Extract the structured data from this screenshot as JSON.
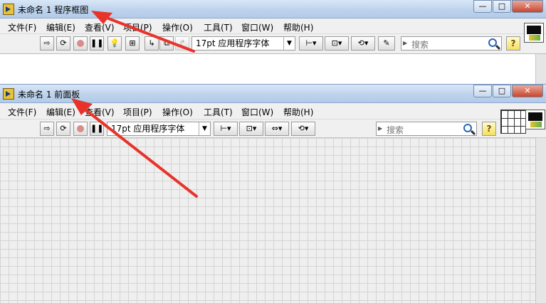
{
  "block_diagram": {
    "title": "未命名 1 程序框图",
    "menus": [
      "文件(F)",
      "编辑(E)",
      "查看(V)",
      "项目(P)",
      "操作(O)",
      "工具(T)",
      "窗口(W)",
      "帮助(H)"
    ],
    "font_select": "17pt 应用程序字体",
    "search_placeholder": "搜索",
    "help_label": "?"
  },
  "front_panel": {
    "title": "未命名 1 前面板",
    "menus": [
      "文件(F)",
      "编辑(E)",
      "查看(V)",
      "项目(P)",
      "操作(O)",
      "工具(T)",
      "窗口(W)",
      "帮助(H)"
    ],
    "font_select": "17pt 应用程序字体",
    "search_placeholder": "搜索",
    "help_label": "?"
  },
  "window_buttons": {
    "minimize": "—",
    "maximize": "□",
    "close": "✕"
  },
  "colors": {
    "arrow": "#e8332a",
    "titlebar": "#c9dcf1",
    "grid": "#d4d4d4"
  },
  "icons": [
    "run-arrow-icon",
    "run-continuous-icon",
    "abort-icon",
    "pause-icon",
    "highlight-bulb-icon",
    "retain-wire-icon",
    "step-into-icon",
    "step-over-icon",
    "step-out-icon",
    "align-icon",
    "distribute-icon",
    "resize-icon",
    "reorder-icon",
    "search-icon",
    "help-icon"
  ]
}
